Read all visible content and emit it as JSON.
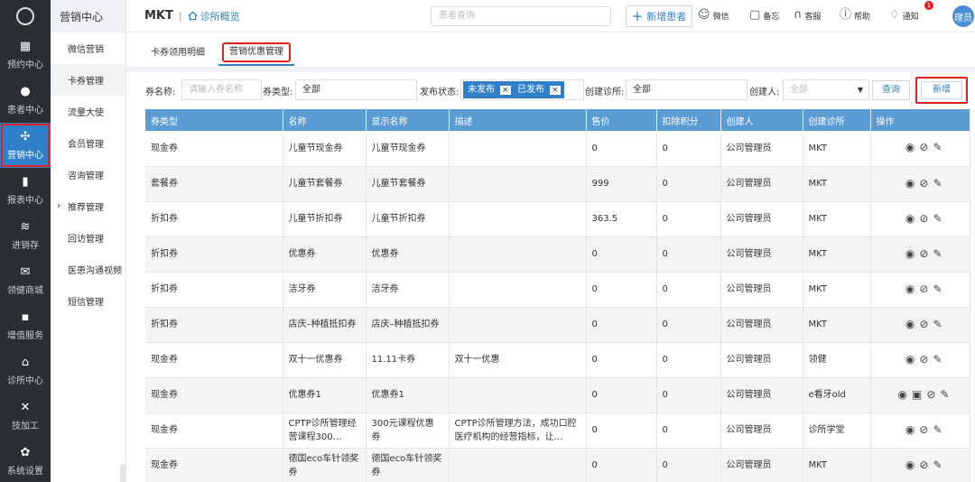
{
  "app": {
    "brand": "MKT",
    "home_link": "诊所概览"
  },
  "rail": {
    "items": [
      {
        "label": "预约中心",
        "icon": "calendar-icon"
      },
      {
        "label": "患者中心",
        "icon": "user-icon"
      },
      {
        "label": "营销中心",
        "icon": "grid-icon",
        "active": true
      },
      {
        "label": "报表中心",
        "icon": "bar-chart-icon"
      },
      {
        "label": "进销存",
        "icon": "layers-icon"
      },
      {
        "label": "领健商城",
        "icon": "mail-icon"
      },
      {
        "label": "增值服务",
        "icon": "apps-icon"
      },
      {
        "label": "诊所中心",
        "icon": "home-icon"
      },
      {
        "label": "技加工",
        "icon": "tools-icon"
      },
      {
        "label": "系统设置",
        "icon": "gear-icon"
      }
    ]
  },
  "sub": {
    "title": "营销中心",
    "items": [
      {
        "label": "微信营销"
      },
      {
        "label": "卡券管理",
        "active": true
      },
      {
        "label": "流量大使"
      },
      {
        "label": "会员管理"
      },
      {
        "label": "咨询管理"
      },
      {
        "label": "推荐管理",
        "caret": "›"
      },
      {
        "label": "回访管理"
      },
      {
        "label": "医患沟通视频"
      },
      {
        "label": "短信管理"
      }
    ]
  },
  "header": {
    "search_placeholder": "患者查询",
    "add_patient": "新增患者",
    "tools": {
      "wechat": "微信",
      "memo": "备忘",
      "service": "客服",
      "help": "帮助",
      "notify": "通知"
    },
    "notify_badge": "1",
    "user": "理员"
  },
  "tabs": [
    {
      "label": "卡券领用明细"
    },
    {
      "label": "营销优惠管理",
      "active": true
    }
  ],
  "filters": {
    "name_label": "券名称:",
    "name_placeholder": "请输入券名称",
    "type_label": "券类型:",
    "type_value": "全部",
    "status_label": "发布状态:",
    "status_chips": [
      "未发布",
      "已发布"
    ],
    "chip_close": "×",
    "clinic_label": "创建诊所:",
    "clinic_value": "全部",
    "creator_label": "创建人:",
    "creator_value": "全部",
    "dropdown_arrow": "▼",
    "query_button": "查询",
    "new_button": "新增"
  },
  "table": {
    "headers": [
      "券类型",
      "名称",
      "显示名称",
      "描述",
      "售价",
      "扣除积分",
      "创建人",
      "创建诊所",
      "操作"
    ],
    "rows": [
      {
        "type": "现金券",
        "name": "儿童节现金券",
        "display": "儿童节现金券",
        "desc": "",
        "price": "0",
        "points": "0",
        "creator": "公司管理员",
        "clinic": "MKT"
      },
      {
        "type": "套餐券",
        "name": "儿童节套餐券",
        "display": "儿童节套餐券",
        "desc": "",
        "price": "999",
        "points": "0",
        "creator": "公司管理员",
        "clinic": "MKT"
      },
      {
        "type": "折扣券",
        "name": "儿童节折扣券",
        "display": "儿童节折扣券",
        "desc": "",
        "price": "363.5",
        "points": "0",
        "creator": "公司管理员",
        "clinic": "MKT"
      },
      {
        "type": "折扣券",
        "name": "优惠券",
        "display": "优惠券",
        "desc": "",
        "price": "0",
        "points": "0",
        "creator": "公司管理员",
        "clinic": "MKT"
      },
      {
        "type": "折扣券",
        "name": "洁牙券",
        "display": "洁牙券",
        "desc": "",
        "price": "0",
        "points": "0",
        "creator": "公司管理员",
        "clinic": "MKT"
      },
      {
        "type": "折扣券",
        "name": "店庆–种植抵扣券",
        "display": "店庆–种植抵扣券",
        "desc": "",
        "price": "0",
        "points": "0",
        "creator": "公司管理员",
        "clinic": "MKT"
      },
      {
        "type": "现金券",
        "name": "双十一优惠券",
        "display": "11.11卡券",
        "desc": "双十一优惠",
        "price": "0",
        "points": "0",
        "creator": "公司管理员",
        "clinic": "领健"
      },
      {
        "type": "现金券",
        "name": "优惠券1",
        "display": "优惠券1",
        "desc": "",
        "price": "0",
        "points": "0",
        "creator": "公司管理员",
        "clinic": "e看牙old",
        "extra_op": true
      },
      {
        "type": "现金券",
        "name": "CPTP诊所管理经营课程300…",
        "display": "300元课程优惠券",
        "desc": "CPTP诊所管理方法，成功口腔医疗机构的经营指标，让…",
        "price": "0",
        "points": "0",
        "creator": "公司管理员",
        "clinic": "诊所学堂"
      },
      {
        "type": "现金券",
        "name": "德国eco车针领奖券",
        "display": "德国eco车针领奖券",
        "desc": "",
        "price": "0",
        "points": "0",
        "creator": "公司管理员",
        "clinic": "MKT"
      }
    ]
  }
}
